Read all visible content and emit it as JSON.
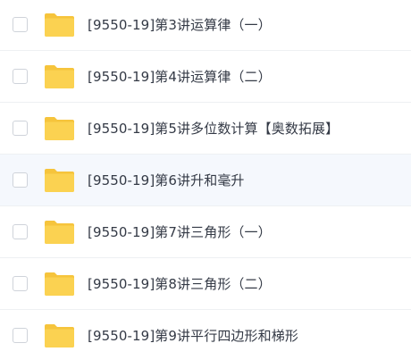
{
  "colors": {
    "folder_back": "#f6c43c",
    "folder_front": "#fbd251",
    "text": "#343a46",
    "highlight_row": "#f5f8fd",
    "checkbox_border": "#cfd3da"
  },
  "files": [
    {
      "name": "[9550-19]第3讲运算律（一）",
      "icon": "folder-icon",
      "highlighted": false
    },
    {
      "name": "[9550-19]第4讲运算律（二）",
      "icon": "folder-icon",
      "highlighted": false
    },
    {
      "name": "[9550-19]第5讲多位数计算【奥数拓展】",
      "icon": "folder-icon",
      "highlighted": false
    },
    {
      "name": "[9550-19]第6讲升和毫升",
      "icon": "folder-icon",
      "highlighted": true
    },
    {
      "name": "[9550-19]第7讲三角形（一）",
      "icon": "folder-icon",
      "highlighted": false
    },
    {
      "name": "[9550-19]第8讲三角形（二）",
      "icon": "folder-icon",
      "highlighted": false
    },
    {
      "name": "[9550-19]第9讲平行四边形和梯形",
      "icon": "folder-icon",
      "highlighted": false
    }
  ]
}
